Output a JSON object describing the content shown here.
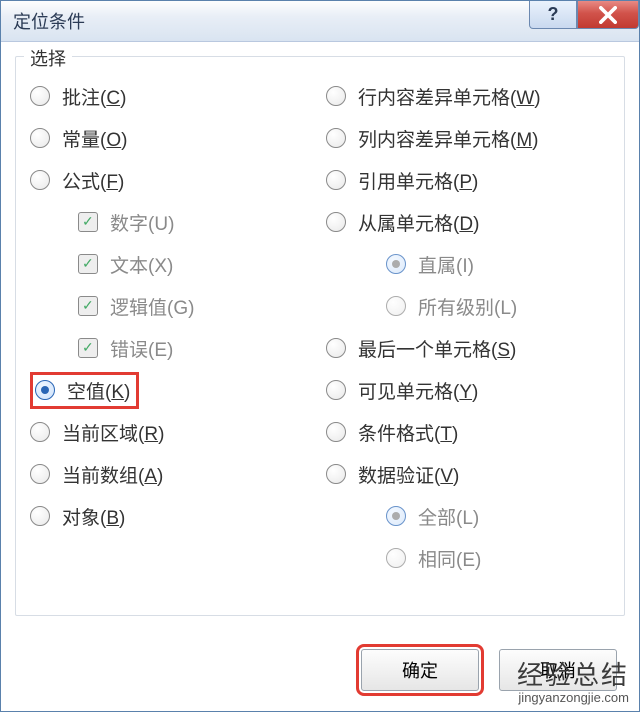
{
  "title": "定位条件",
  "group_label": "选择",
  "left": [
    {
      "label": "批注",
      "key": "C"
    },
    {
      "label": "常量",
      "key": "O"
    },
    {
      "label": "公式",
      "key": "F"
    },
    {
      "label": "空值",
      "key": "K",
      "selected": true,
      "highlight": true
    },
    {
      "label": "当前区域",
      "key": "R"
    },
    {
      "label": "当前数组",
      "key": "A"
    },
    {
      "label": "对象",
      "key": "B"
    }
  ],
  "formula_sub": [
    {
      "label": "数字",
      "key": "U",
      "checked": true
    },
    {
      "label": "文本",
      "key": "X",
      "checked": true
    },
    {
      "label": "逻辑值",
      "key": "G",
      "checked": true
    },
    {
      "label": "错误",
      "key": "E",
      "checked": true
    }
  ],
  "right": [
    {
      "label": "行内容差异单元格",
      "key": "W"
    },
    {
      "label": "列内容差异单元格",
      "key": "M"
    },
    {
      "label": "引用单元格",
      "key": "P"
    },
    {
      "label": "从属单元格",
      "key": "D"
    },
    {
      "label": "最后一个单元格",
      "key": "S"
    },
    {
      "label": "可见单元格",
      "key": "Y"
    },
    {
      "label": "条件格式",
      "key": "T"
    },
    {
      "label": "数据验证",
      "key": "V"
    }
  ],
  "dependents_sub": [
    {
      "label": "直属",
      "key": "I",
      "selected": true
    },
    {
      "label": "所有级别",
      "key": "L"
    }
  ],
  "validation_sub": [
    {
      "label": "全部",
      "key": "L",
      "selected": true
    },
    {
      "label": "相同",
      "key": "E"
    }
  ],
  "buttons": {
    "ok": "确定",
    "cancel": "取消"
  },
  "watermark": {
    "cn": "经验总结",
    "en": "jingyanzongjie.com"
  }
}
